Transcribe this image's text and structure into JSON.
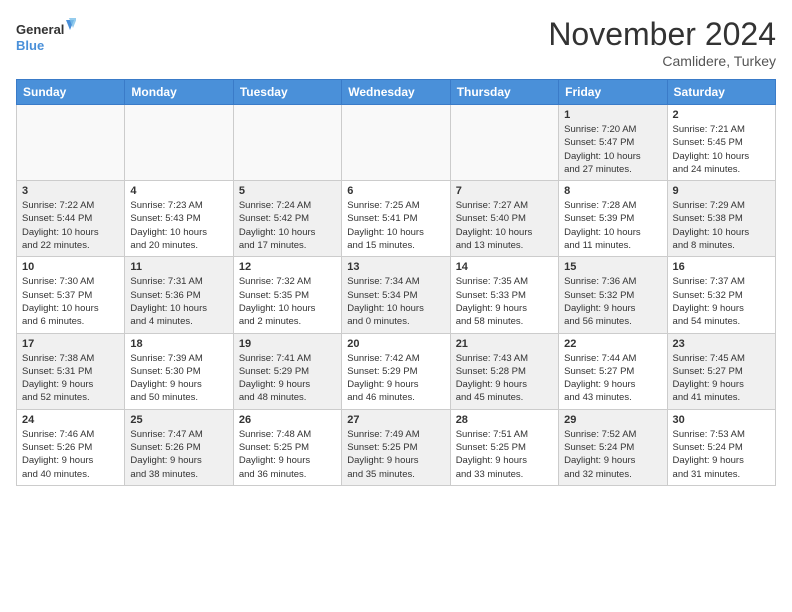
{
  "logo": {
    "line1": "General",
    "line2": "Blue"
  },
  "title": "November 2024",
  "location": "Camlidere, Turkey",
  "days_of_week": [
    "Sunday",
    "Monday",
    "Tuesday",
    "Wednesday",
    "Thursday",
    "Friday",
    "Saturday"
  ],
  "weeks": [
    [
      {
        "day": "",
        "info": "",
        "empty": true
      },
      {
        "day": "",
        "info": "",
        "empty": true
      },
      {
        "day": "",
        "info": "",
        "empty": true
      },
      {
        "day": "",
        "info": "",
        "empty": true
      },
      {
        "day": "",
        "info": "",
        "empty": true
      },
      {
        "day": "1",
        "info": "Sunrise: 7:20 AM\nSunset: 5:47 PM\nDaylight: 10 hours\nand 27 minutes.",
        "shaded": true
      },
      {
        "day": "2",
        "info": "Sunrise: 7:21 AM\nSunset: 5:45 PM\nDaylight: 10 hours\nand 24 minutes.",
        "shaded": false
      }
    ],
    [
      {
        "day": "3",
        "info": "Sunrise: 7:22 AM\nSunset: 5:44 PM\nDaylight: 10 hours\nand 22 minutes.",
        "shaded": true
      },
      {
        "day": "4",
        "info": "Sunrise: 7:23 AM\nSunset: 5:43 PM\nDaylight: 10 hours\nand 20 minutes.",
        "shaded": false
      },
      {
        "day": "5",
        "info": "Sunrise: 7:24 AM\nSunset: 5:42 PM\nDaylight: 10 hours\nand 17 minutes.",
        "shaded": true
      },
      {
        "day": "6",
        "info": "Sunrise: 7:25 AM\nSunset: 5:41 PM\nDaylight: 10 hours\nand 15 minutes.",
        "shaded": false
      },
      {
        "day": "7",
        "info": "Sunrise: 7:27 AM\nSunset: 5:40 PM\nDaylight: 10 hours\nand 13 minutes.",
        "shaded": true
      },
      {
        "day": "8",
        "info": "Sunrise: 7:28 AM\nSunset: 5:39 PM\nDaylight: 10 hours\nand 11 minutes.",
        "shaded": false
      },
      {
        "day": "9",
        "info": "Sunrise: 7:29 AM\nSunset: 5:38 PM\nDaylight: 10 hours\nand 8 minutes.",
        "shaded": true
      }
    ],
    [
      {
        "day": "10",
        "info": "Sunrise: 7:30 AM\nSunset: 5:37 PM\nDaylight: 10 hours\nand 6 minutes.",
        "shaded": false
      },
      {
        "day": "11",
        "info": "Sunrise: 7:31 AM\nSunset: 5:36 PM\nDaylight: 10 hours\nand 4 minutes.",
        "shaded": true
      },
      {
        "day": "12",
        "info": "Sunrise: 7:32 AM\nSunset: 5:35 PM\nDaylight: 10 hours\nand 2 minutes.",
        "shaded": false
      },
      {
        "day": "13",
        "info": "Sunrise: 7:34 AM\nSunset: 5:34 PM\nDaylight: 10 hours\nand 0 minutes.",
        "shaded": true
      },
      {
        "day": "14",
        "info": "Sunrise: 7:35 AM\nSunset: 5:33 PM\nDaylight: 9 hours\nand 58 minutes.",
        "shaded": false
      },
      {
        "day": "15",
        "info": "Sunrise: 7:36 AM\nSunset: 5:32 PM\nDaylight: 9 hours\nand 56 minutes.",
        "shaded": true
      },
      {
        "day": "16",
        "info": "Sunrise: 7:37 AM\nSunset: 5:32 PM\nDaylight: 9 hours\nand 54 minutes.",
        "shaded": false
      }
    ],
    [
      {
        "day": "17",
        "info": "Sunrise: 7:38 AM\nSunset: 5:31 PM\nDaylight: 9 hours\nand 52 minutes.",
        "shaded": true
      },
      {
        "day": "18",
        "info": "Sunrise: 7:39 AM\nSunset: 5:30 PM\nDaylight: 9 hours\nand 50 minutes.",
        "shaded": false
      },
      {
        "day": "19",
        "info": "Sunrise: 7:41 AM\nSunset: 5:29 PM\nDaylight: 9 hours\nand 48 minutes.",
        "shaded": true
      },
      {
        "day": "20",
        "info": "Sunrise: 7:42 AM\nSunset: 5:29 PM\nDaylight: 9 hours\nand 46 minutes.",
        "shaded": false
      },
      {
        "day": "21",
        "info": "Sunrise: 7:43 AM\nSunset: 5:28 PM\nDaylight: 9 hours\nand 45 minutes.",
        "shaded": true
      },
      {
        "day": "22",
        "info": "Sunrise: 7:44 AM\nSunset: 5:27 PM\nDaylight: 9 hours\nand 43 minutes.",
        "shaded": false
      },
      {
        "day": "23",
        "info": "Sunrise: 7:45 AM\nSunset: 5:27 PM\nDaylight: 9 hours\nand 41 minutes.",
        "shaded": true
      }
    ],
    [
      {
        "day": "24",
        "info": "Sunrise: 7:46 AM\nSunset: 5:26 PM\nDaylight: 9 hours\nand 40 minutes.",
        "shaded": false
      },
      {
        "day": "25",
        "info": "Sunrise: 7:47 AM\nSunset: 5:26 PM\nDaylight: 9 hours\nand 38 minutes.",
        "shaded": true
      },
      {
        "day": "26",
        "info": "Sunrise: 7:48 AM\nSunset: 5:25 PM\nDaylight: 9 hours\nand 36 minutes.",
        "shaded": false
      },
      {
        "day": "27",
        "info": "Sunrise: 7:49 AM\nSunset: 5:25 PM\nDaylight: 9 hours\nand 35 minutes.",
        "shaded": true
      },
      {
        "day": "28",
        "info": "Sunrise: 7:51 AM\nSunset: 5:25 PM\nDaylight: 9 hours\nand 33 minutes.",
        "shaded": false
      },
      {
        "day": "29",
        "info": "Sunrise: 7:52 AM\nSunset: 5:24 PM\nDaylight: 9 hours\nand 32 minutes.",
        "shaded": true
      },
      {
        "day": "30",
        "info": "Sunrise: 7:53 AM\nSunset: 5:24 PM\nDaylight: 9 hours\nand 31 minutes.",
        "shaded": false
      }
    ]
  ]
}
